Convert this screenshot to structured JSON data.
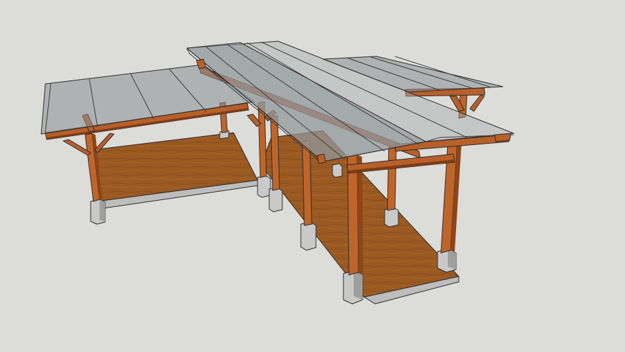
{
  "scene": {
    "colors": {
      "background": "#dcdcd8",
      "timber": "#c0652a",
      "timber_dark": "#8e4618",
      "deck_wood": "#9a5a22",
      "concrete": "#c9c9c9",
      "roof_glazing": "#8a8f93"
    }
  }
}
